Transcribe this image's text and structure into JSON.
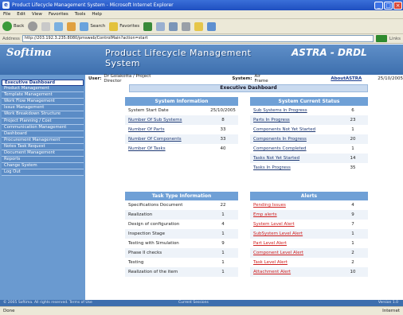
{
  "window": {
    "title": "Product Lifecycle Management System - Microsoft Internet Explorer",
    "menu": [
      "File",
      "Edit",
      "View",
      "Favorites",
      "Tools",
      "Help"
    ],
    "toolbar": {
      "back": "Back",
      "search": "Search",
      "favorites": "Favorites"
    },
    "address": {
      "label": "Address",
      "value": "http://203.192.3.235:8080/pmsweb/ControlMain?action=start",
      "links": "Links"
    },
    "status": {
      "left": "Done",
      "zone": "Internet"
    }
  },
  "app": {
    "logo": "Softima",
    "name": "Product Lifecycle Management System",
    "brand": "ASTRA - DRDL"
  },
  "userbar": {
    "user_label": "User:",
    "user_value": "Dr Golakotta / Project Director",
    "system_label": "System:",
    "system_value": "Air Frame",
    "about": "AboutASTRA",
    "date": "25/10/2005"
  },
  "sidebar": {
    "items": [
      "Executive Dashboard",
      "Product Management",
      "Template Management",
      "Work Flow Management",
      "Issue Management",
      "Work Breakdown Structure",
      "Project Planning / Cost",
      "Communication Management",
      "Dashboard",
      "Procurement Management",
      "Notes Task Request",
      "Document Management",
      "Reports",
      "Change System",
      "Log Out"
    ]
  },
  "main": {
    "title": "Executive Dashboard",
    "system_info": {
      "heading": "System Information",
      "rows": [
        {
          "label": "System Start Date",
          "value": "25/10/2005",
          "link": false
        },
        {
          "label": "Number Of Sub Systems",
          "value": "8",
          "link": true
        },
        {
          "label": "Number Of Parts",
          "value": "33",
          "link": true
        },
        {
          "label": "Number Of Components",
          "value": "33",
          "link": true
        },
        {
          "label": "Number Of Tasks",
          "value": "40",
          "link": true
        }
      ]
    },
    "current_status": {
      "heading": "System Current Status",
      "rows": [
        {
          "label": "Sub Systems In Progress",
          "value": "6"
        },
        {
          "label": "Parts In Progress",
          "value": "23"
        },
        {
          "label": "Components Not Yet Started",
          "value": "1"
        },
        {
          "label": "Components In Progress",
          "value": "20"
        },
        {
          "label": "Components Completed",
          "value": "1"
        },
        {
          "label": "Tasks Not Yet Started",
          "value": "14"
        },
        {
          "label": "Tasks In Progress",
          "value": "35"
        }
      ]
    },
    "task_type": {
      "heading": "Task Type Information",
      "rows": [
        {
          "label": "Specifications Document",
          "value": "22"
        },
        {
          "label": "Realization",
          "value": "1"
        },
        {
          "label": "Design of configuration",
          "value": "4"
        },
        {
          "label": "Inspection Stage",
          "value": "1"
        },
        {
          "label": "Testing with Simulation",
          "value": "9"
        },
        {
          "label": "Phase II checks",
          "value": "1"
        },
        {
          "label": "Testing",
          "value": "1"
        },
        {
          "label": "Realization of the item",
          "value": "1"
        }
      ]
    },
    "alerts": {
      "heading": "Alerts",
      "rows": [
        {
          "label": "Pending Issues",
          "value": "4"
        },
        {
          "label": "Emp alerts",
          "value": "9"
        },
        {
          "label": "System Level Alert",
          "value": "7"
        },
        {
          "label": "SubSystem Level Alert",
          "value": "1"
        },
        {
          "label": "Part Level Alert",
          "value": "1"
        },
        {
          "label": "Component Level Alert",
          "value": "2"
        },
        {
          "label": "Task Level Alert",
          "value": "2"
        },
        {
          "label": "Attachment Alert",
          "value": "10"
        }
      ]
    }
  },
  "footer": {
    "copyright": "© 2005 Softima. All rights reserved. Terms of Use",
    "center": "Current Sessions",
    "version": "Version 1.0"
  },
  "colors": {
    "header": "#3d6fae",
    "panel_head": "#6fa0d6",
    "sidebar": "#6a9ad0",
    "alert": "#d02020"
  }
}
